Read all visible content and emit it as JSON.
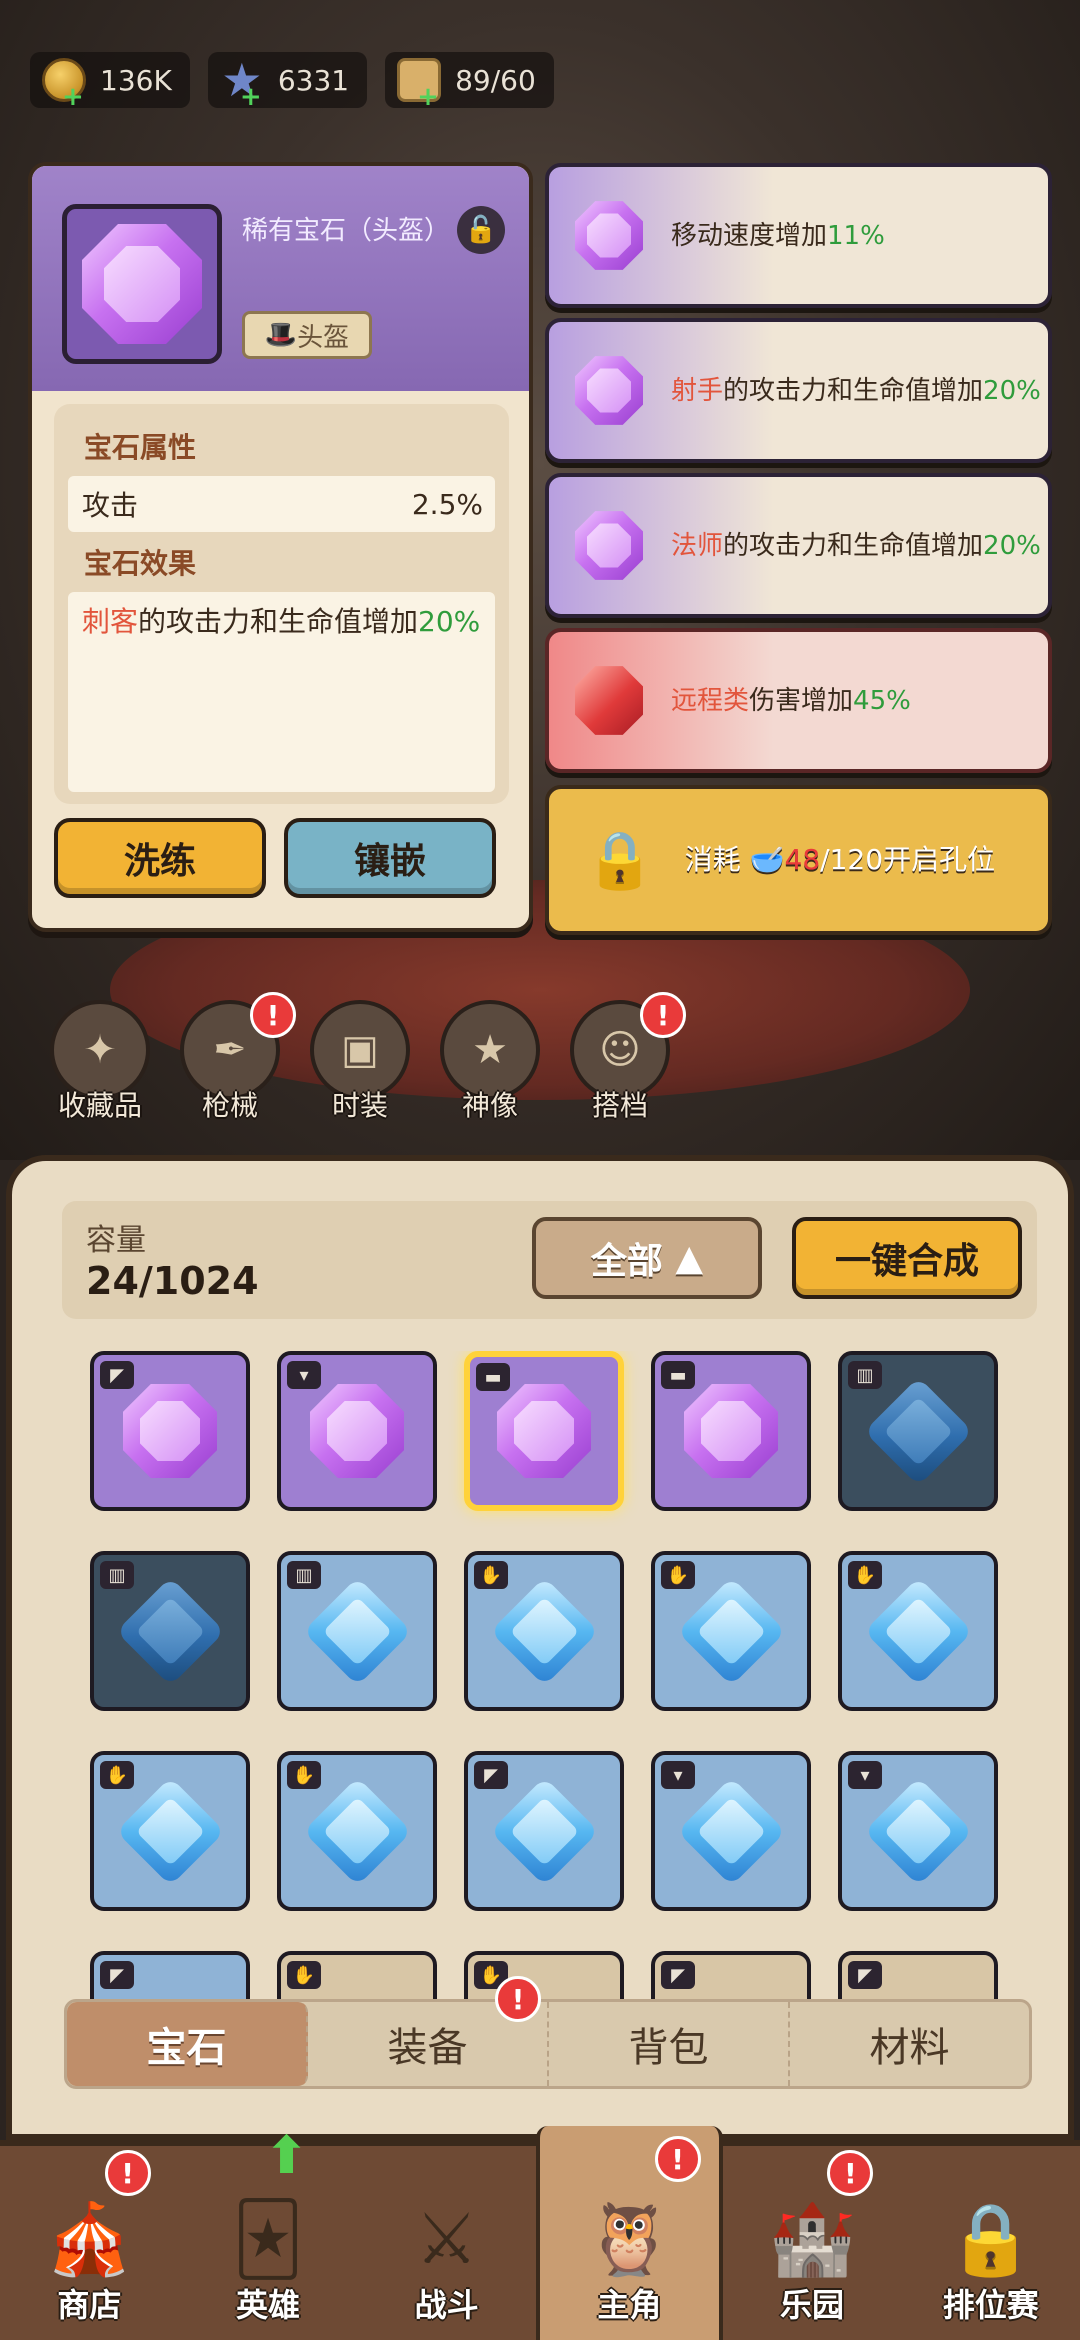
{
  "topbar": {
    "coins": "136K",
    "stars": "6331",
    "stamina": "89/60",
    "icons": [
      "coin-icon",
      "star-icon",
      "cracker-icon"
    ]
  },
  "detail": {
    "title": "稀有宝石（头盔）",
    "type_badge": "头盔",
    "attr_section": "宝石属性",
    "attr_name": "攻击",
    "attr_value": "2.5%",
    "effect_section": "宝石效果",
    "effect_hl": "刺客",
    "effect_text": "的攻击力和生命值增加",
    "effect_value": "20%",
    "btn_refine": "洗练",
    "btn_inlay": "镶嵌"
  },
  "slots": {
    "s1_text": "移动速度增加",
    "s1_value": "11%",
    "s2_hl": "射手",
    "s2_text": "的攻击力和生命值增加",
    "s2_value": "20%",
    "s3_hl": "法师",
    "s3_text": "的攻击力和生命值增加",
    "s3_value": "20%",
    "s4_hl": "远程类",
    "s4_text": "伤害增加",
    "s4_value": "45%",
    "lock_prefix": "消耗",
    "lock_have": "48",
    "lock_need": "/120",
    "lock_suffix": "开启孔位"
  },
  "categories": [
    {
      "label": "收藏品",
      "badge": false
    },
    {
      "label": "枪械",
      "badge": true
    },
    {
      "label": "时装",
      "badge": false
    },
    {
      "label": "神像",
      "badge": false
    },
    {
      "label": "搭档",
      "badge": true
    }
  ],
  "inventory": {
    "capacity_label": "容量",
    "capacity_value": "24/1024",
    "filter_label": "全部",
    "merge_label": "一键合成"
  },
  "tabs": [
    "宝石",
    "装备",
    "背包",
    "材料"
  ],
  "nav": [
    "商店",
    "英雄",
    "战斗",
    "主角",
    "乐园",
    "排位赛"
  ],
  "colors": {
    "accent_yellow": "#f2b334",
    "purple_tile": "#9e7fd1",
    "blue_tile": "#8fb3d6",
    "highlight_red": "#e2553c",
    "value_green": "#2f9c3c"
  }
}
